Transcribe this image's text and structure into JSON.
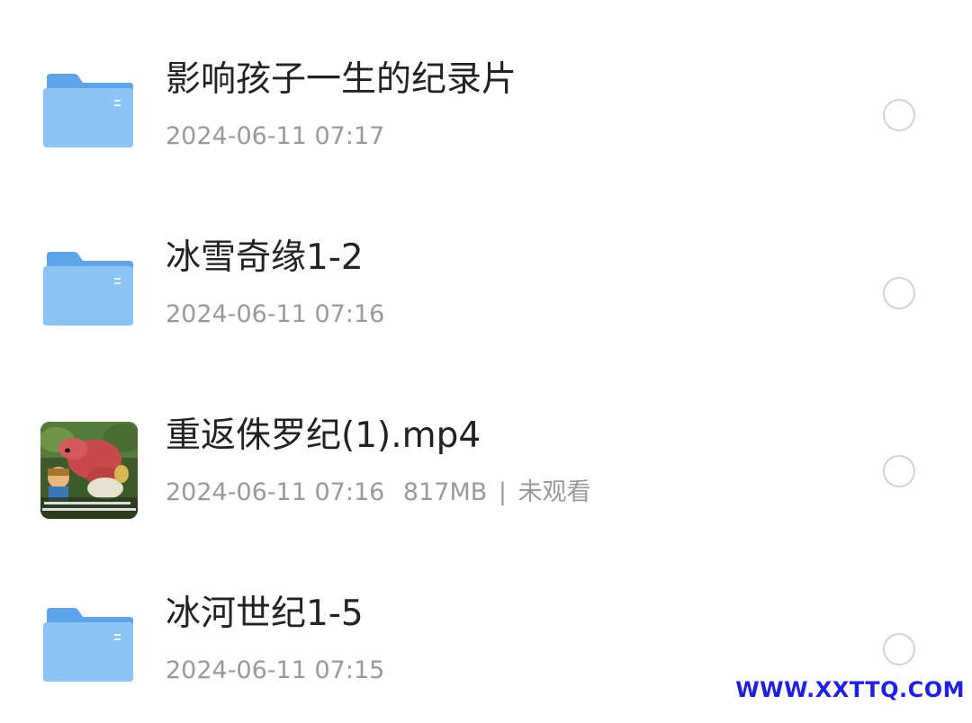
{
  "files": [
    {
      "type": "folder",
      "icon": "folder-icon",
      "name": "影响孩子一生的纪录片",
      "date": "2024-06-11 07:17"
    },
    {
      "type": "folder",
      "icon": "folder-icon",
      "name": "冰雪奇缘1-2",
      "date": "2024-06-11 07:16"
    },
    {
      "type": "video",
      "icon": "video-thumbnail",
      "name": "重返侏罗纪(1).mp4",
      "date": "2024-06-11 07:16",
      "size": "817MB",
      "separator": "|",
      "watch_status": "未观看"
    },
    {
      "type": "folder",
      "icon": "folder-icon",
      "name": "冰河世纪1-5",
      "date": "2024-06-11 07:15"
    }
  ],
  "watermark": "WWW.XXTTQ.COM",
  "colors": {
    "folder": "#7db9f0",
    "name_text": "#222222",
    "meta_text": "#9a9a9a",
    "radio_border": "#d2d2d2",
    "watermark": "#1f1fe6"
  }
}
